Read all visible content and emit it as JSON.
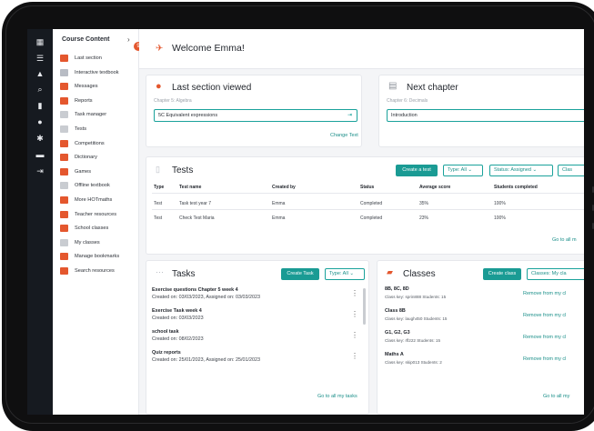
{
  "sidebar": {
    "heading": "Course Content",
    "collapse_glyph": "›",
    "badge": "9",
    "rail_icons": [
      "grid-icon",
      "list-icon",
      "bell-icon",
      "search-icon",
      "book-icon",
      "help-icon",
      "settings-icon",
      "message-icon",
      "logout-icon"
    ],
    "items": [
      {
        "label": "Last section",
        "color": "#e4572e"
      },
      {
        "label": "Interactive textbook",
        "color": "#b8bcc4"
      },
      {
        "label": "Messages",
        "color": "#e4572e"
      },
      {
        "label": "Reports",
        "color": "#e4572e"
      },
      {
        "label": "Task manager",
        "color": "#c9ccd1"
      },
      {
        "label": "Tests",
        "color": "#c9ccd1"
      },
      {
        "label": "Competitions",
        "color": "#e4572e"
      },
      {
        "label": "Dictionary",
        "color": "#e4572e"
      },
      {
        "label": "Games",
        "color": "#e4572e"
      },
      {
        "label": "Offline textbook",
        "color": "#c9ccd1"
      },
      {
        "label": "More HOTmaths",
        "color": "#e4572e"
      },
      {
        "label": "Teacher resources",
        "color": "#e4572e"
      },
      {
        "label": "School classes",
        "color": "#e4572e"
      },
      {
        "label": "My classes",
        "color": "#c9ccd1"
      },
      {
        "label": "Manage bookmarks",
        "color": "#e4572e"
      },
      {
        "label": "Search resources",
        "color": "#e4572e"
      }
    ]
  },
  "header": {
    "welcome": "Welcome Emma!"
  },
  "last_section": {
    "title": "Last section viewed",
    "chapter": "Chapter 5: Algebra",
    "value": "5C Equivalent expressions",
    "arrow": "⇥",
    "change_link": "Change Text"
  },
  "next_chapter": {
    "title": "Next chapter",
    "chapter": "Chapter 6: Decimals",
    "value": "Introduction"
  },
  "tests": {
    "title": "Tests",
    "create_button": "Create a test",
    "type_filter": "Type: All",
    "status_filter": "Status: Assigned",
    "class_filter": "Clas",
    "columns": [
      "Type",
      "Test name",
      "Created by",
      "Status",
      "Average score",
      "Students completed"
    ],
    "rows": [
      [
        "Test",
        "Task test year 7",
        "Emma",
        "Completed",
        "35%",
        "100%"
      ],
      [
        "Test",
        "Check Test Maria",
        "Emma",
        "Completed",
        "23%",
        "100%"
      ]
    ],
    "footer_link": "Go to all m"
  },
  "tasks": {
    "title": "Tasks",
    "create_button": "Create Task",
    "type_filter": "Type: All",
    "items": [
      {
        "name": "Exercise questions Chapter 5 week 4",
        "meta": "Created on: 03/03/2023, Assigned on: 03/03/2023"
      },
      {
        "name": "Exercise Task week 4",
        "meta": "Created on: 03/03/2023"
      },
      {
        "name": "school task",
        "meta": "Created on: 08/02/2023"
      },
      {
        "name": "Quiz reports",
        "meta": "Created on: 25/01/2023, Assigned on: 25/01/2023"
      }
    ],
    "footer_link": "Go to all my tasks"
  },
  "classes": {
    "title": "Classes",
    "create_button": "Create class",
    "filter": "Classes: My cla",
    "items": [
      {
        "name": "8B, 8C, 8D",
        "meta": "Class key: sprin888   Students: 15",
        "action": "Remove from my cl"
      },
      {
        "name": "Class 8B",
        "meta": "Class key: laugh450   Students: 15",
        "action": "Remove from my cl"
      },
      {
        "name": "G1, G2, G3",
        "meta": "Class key: rfl222   Students: 15",
        "action": "Remove from my cl"
      },
      {
        "name": "Maths A",
        "meta": "Class key: skip013   Students: 2",
        "action": "Remove from my cl"
      }
    ],
    "footer_link": "Go to all my"
  }
}
